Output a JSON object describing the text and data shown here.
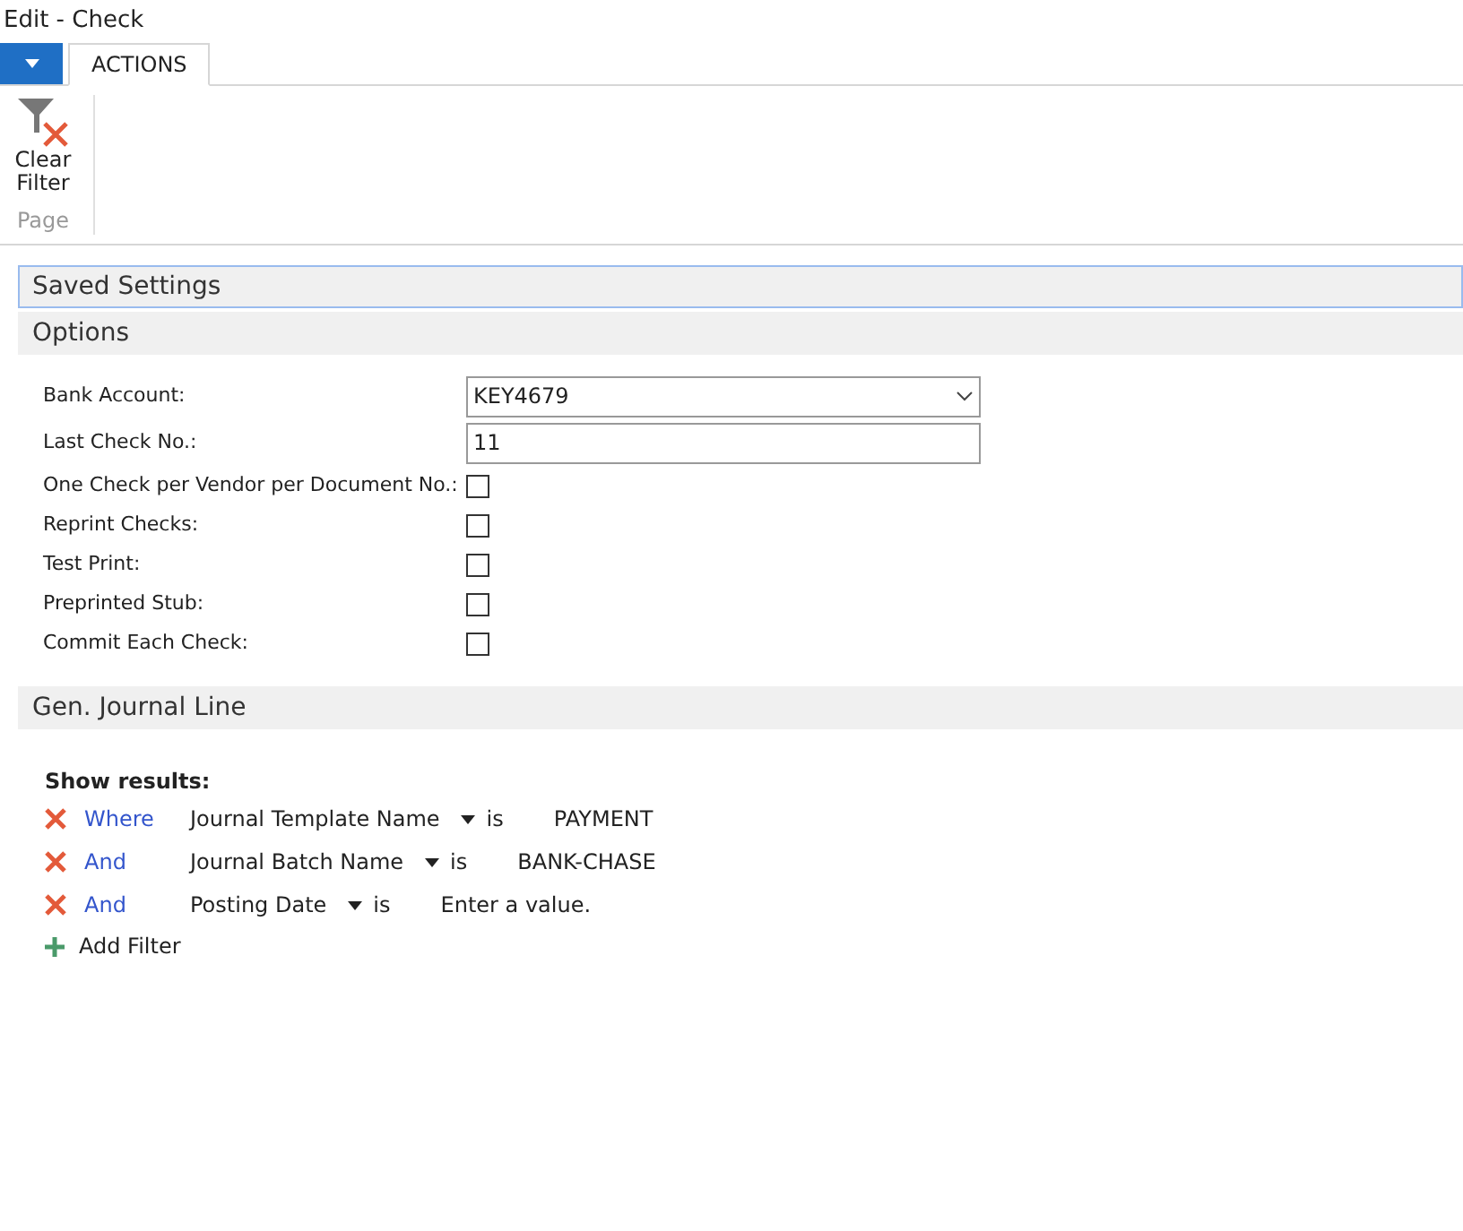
{
  "window": {
    "title": "Edit - Check"
  },
  "tabs": [
    {
      "label": "ACTIONS",
      "selected": true
    }
  ],
  "ribbon": {
    "buttons": [
      {
        "label": "Clear Filter"
      }
    ],
    "group": "Page"
  },
  "sections": [
    {
      "title": "Saved Settings",
      "focused": true
    },
    {
      "title": "Options",
      "focused": false
    }
  ],
  "options": [
    {
      "kind": "dropdown",
      "label": "Bank Account:",
      "value": "KEY4679"
    },
    {
      "kind": "text",
      "label": "Last Check No.:",
      "value": "11"
    },
    {
      "kind": "checkbox",
      "label": "One Check per Vendor per Document No.:",
      "checked": false
    },
    {
      "kind": "checkbox",
      "label": "Reprint Checks:",
      "checked": false
    },
    {
      "kind": "checkbox",
      "label": "Test Print:",
      "checked": false
    },
    {
      "kind": "checkbox",
      "label": "Preprinted Stub:",
      "checked": false
    },
    {
      "kind": "checkbox",
      "label": "Commit Each Check:",
      "checked": false
    }
  ],
  "filter_section": {
    "title": "Gen. Journal Line",
    "heading": "Show results:",
    "filters": [
      {
        "connector": "Where",
        "field": "Journal Template Name",
        "operator": "is",
        "value": "PAYMENT"
      },
      {
        "connector": "And",
        "field": "Journal Batch Name",
        "operator": "is",
        "value": "BANK-CHASE"
      },
      {
        "connector": "And",
        "field": "Posting Date",
        "operator": "is",
        "value": "Enter a value."
      }
    ],
    "add_label": "Add Filter"
  }
}
